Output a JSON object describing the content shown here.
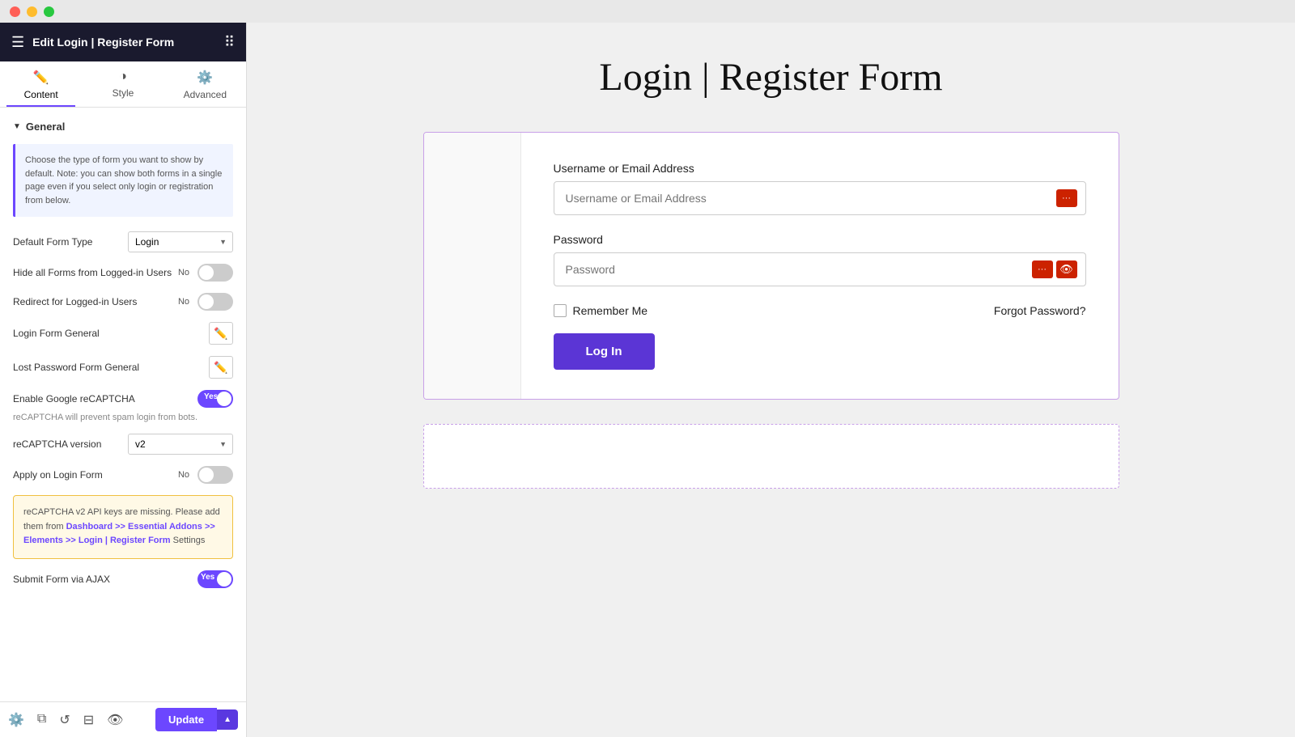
{
  "window": {
    "title": "Edit Login | Register Form"
  },
  "tabs": [
    {
      "id": "content",
      "label": "Content",
      "icon": "✏️",
      "active": true
    },
    {
      "id": "style",
      "label": "Style",
      "icon": "◑",
      "active": false
    },
    {
      "id": "advanced",
      "label": "Advanced",
      "icon": "⚙️",
      "active": false
    }
  ],
  "sidebar": {
    "section_general": "General",
    "info_text": "Choose the type of form you want to show by default. Note: you can show both forms in a single page even if you select only login or registration from below.",
    "default_form_type_label": "Default Form Type",
    "default_form_type_value": "Login",
    "hide_forms_label": "Hide all Forms from Logged-in Users",
    "hide_forms_toggle": "off",
    "redirect_label": "Redirect for Logged-in Users",
    "redirect_toggle": "off",
    "login_form_label": "Login Form General",
    "lost_password_label": "Lost Password Form General",
    "recaptcha_label": "Enable Google reCAPTCHA",
    "recaptcha_toggle": "on",
    "recaptcha_note": "reCAPTCHA will prevent spam login from bots.",
    "recaptcha_version_label": "reCAPTCHA version",
    "recaptcha_version_value": "v2",
    "apply_login_label": "Apply on Login Form",
    "apply_login_toggle": "off",
    "warning_text_1": "reCAPTCHA v2 API keys are missing. Please add them from ",
    "warning_link_1": "Dashboard >> Essential Addons >> Elements >> Login | Register Form",
    "warning_text_2": " Settings",
    "submit_ajax_label": "Submit Form via AJAX",
    "submit_ajax_toggle": "on"
  },
  "bottom_toolbar": {
    "update_label": "Update"
  },
  "main": {
    "page_title": "Login | Register Form",
    "form": {
      "username_label": "Username or Email Address",
      "username_placeholder": "Username or Email Address",
      "password_label": "Password",
      "password_placeholder": "Password",
      "remember_label": "Remember Me",
      "forgot_label": "Forgot Password?",
      "login_btn": "Log In"
    }
  }
}
